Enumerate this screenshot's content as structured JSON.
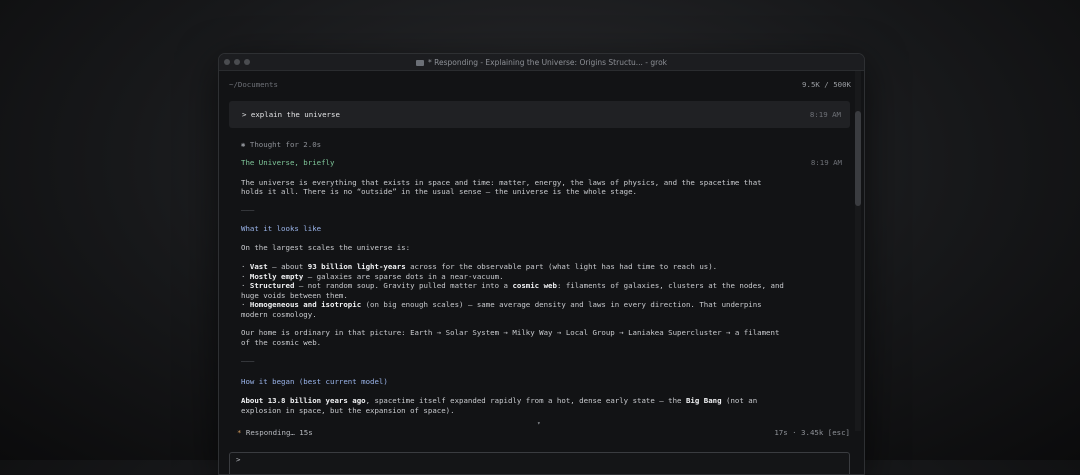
{
  "window": {
    "title": "* Responding - Explaining the Universe: Origins Structu... - grok"
  },
  "header": {
    "cwd": "~/Documents",
    "tokens": "9.5K / 500K"
  },
  "prompt": {
    "text": "> explain the universe",
    "time": "8:19 AM"
  },
  "response": {
    "thought": "✱ Thought for 2.0s",
    "heading": "The Universe, briefly",
    "time": "8:19 AM",
    "intro_1": "The universe is everything that exists in space and time: matter, energy, the laws of physics, and the spacetime that",
    "intro_2": "holds it all. There is no “outside” in the usual sense — the universe is the whole stage.",
    "divider": "———",
    "section_1_title": "What it looks like",
    "scales_intro": "On the largest scales the universe is:",
    "bullets": {
      "b1_bold": "Vast",
      "b1_rest": " — about ",
      "b1_bold2": "93 billion light-years",
      "b1_rest2": " across for the observable part (what light has had time to reach us).",
      "b2_bold": "Mostly empty",
      "b2_rest": " — galaxies are sparse dots in a near-vacuum.",
      "b3_bold": "Structured",
      "b3_rest": " — not random soup. Gravity pulled matter into a ",
      "b3_bold2": "cosmic web",
      "b3_rest2": ": filaments of galaxies, clusters at the nodes, and",
      "b3_cont": "huge voids between them.",
      "b4_bold": "Homogeneous and isotropic",
      "b4_rest": " (on big enough scales) — same average density and laws in every direction. That underpins",
      "b4_cont": "modern cosmology."
    },
    "home_1": "Our home is ordinary in that picture: Earth → Solar System → Milky Way → Local Group → Laniakea Supercluster → a filament",
    "home_2": "of the cosmic web.",
    "section_2_title": "How it began (best current model)",
    "began_bold": "About 13.8 billion years ago",
    "began_rest": ", spacetime itself expanded rapidly from a hot, dense early state — the ",
    "began_bold2": "Big Bang",
    "began_rest2": " (not an",
    "began_2": "explosion in space, but the expansion of space)."
  },
  "status": {
    "spinner": "*",
    "text": "Responding… 15s",
    "right": "17s · 3.45k [esc]"
  },
  "input": {
    "prompt": ">"
  }
}
